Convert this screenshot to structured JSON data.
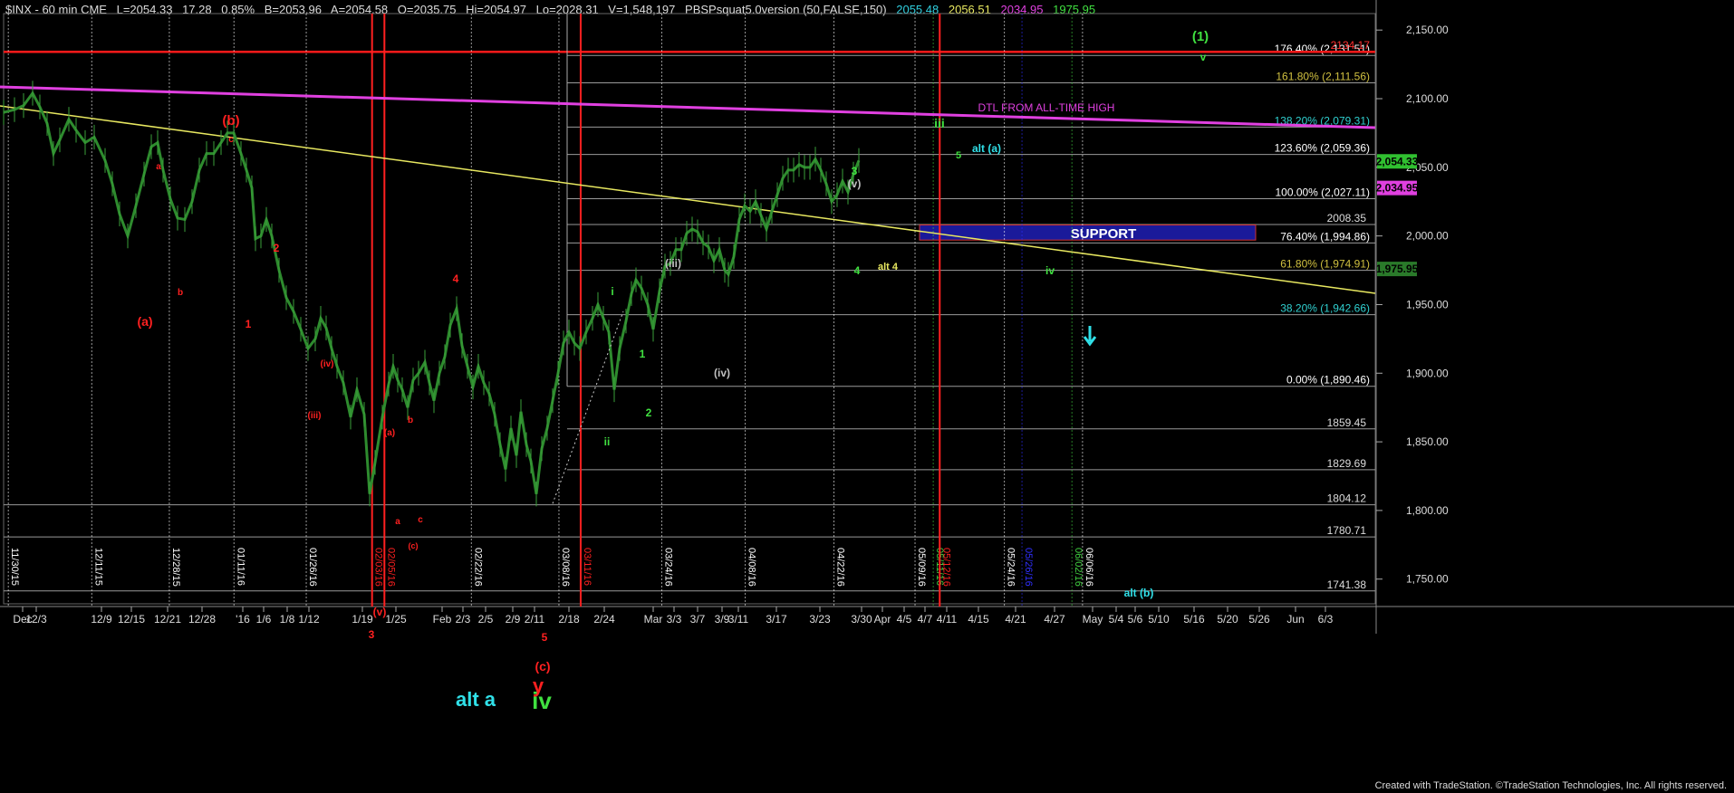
{
  "header": {
    "symbol": "$INX - 60 min  CME",
    "last": "L=2054.33",
    "change": "17.28",
    "change_pct": "0.85%",
    "bid": "B=2053.96",
    "ask": "A=2054.58",
    "open": "O=2035.75",
    "high": "Hi=2054.97",
    "low": "Lo=2028.31",
    "volume": "V=1,548,197",
    "indicator": "PBSPsquat5.0version (50,FALSE,150)",
    "ind_v1": "2055.48",
    "ind_v2": "2056.51",
    "ind_v3": "2034.95",
    "ind_v4": "1975.95"
  },
  "footer": {
    "credit": "Created with TradeStation. ©TradeStation Technologies, Inc. All rights reserved."
  },
  "colors": {
    "background": "#000000",
    "price": "#2e8b2e",
    "red": "#ff1a1a",
    "magenta": "#e040e0",
    "yellow": "#e8e860",
    "cyan": "#30e0e8",
    "green": "#40e040",
    "navy": "#1a1a9a"
  },
  "chart_data": {
    "type": "line",
    "title": "",
    "xlabel": "",
    "ylabel": "",
    "ylim": [
      1732,
      2162
    ],
    "y_ticks": [
      1750,
      1800,
      1850,
      1900,
      1950,
      2000,
      2050,
      2100,
      2150
    ],
    "y_tick_labels": [
      "1,750.00",
      "1,800.00",
      "1,850.00",
      "1,900.00",
      "1,950.00",
      "2,000.00",
      "2,050.00",
      "2,100.00",
      "2,150.00"
    ],
    "x_labels": [
      "Dec",
      "12/3",
      "12/9",
      "12/15",
      "12/21",
      "12/28",
      "'16",
      "1/6",
      "1/8",
      "1/12",
      "1/19",
      "1/25",
      "Feb",
      "2/3",
      "2/5",
      "2/9",
      "2/11",
      "2/18",
      "2/24",
      "Mar",
      "3/3",
      "3/7",
      "3/9",
      "3/11",
      "3/17",
      "3/23",
      "3/30",
      "Apr",
      "4/5",
      "4/7",
      "4/11",
      "4/15",
      "4/21",
      "4/27",
      "May",
      "5/4",
      "5/6",
      "5/10",
      "5/16",
      "5/20",
      "5/26",
      "Jun",
      "6/3"
    ],
    "price_badges": [
      {
        "value": 2054.33,
        "label": "2,054.33",
        "color": "#30c030"
      },
      {
        "value": 2034.95,
        "label": "2,034.95",
        "color": "#e040e0"
      },
      {
        "value": 1975.95,
        "label": "1,975.95",
        "color": "#2a7a2a"
      }
    ],
    "price_series": [
      [
        0,
        2090
      ],
      [
        12,
        2092
      ],
      [
        22,
        2095
      ],
      [
        32,
        2104
      ],
      [
        40,
        2094
      ],
      [
        48,
        2082
      ],
      [
        55,
        2060
      ],
      [
        62,
        2070
      ],
      [
        72,
        2085
      ],
      [
        80,
        2077
      ],
      [
        90,
        2068
      ],
      [
        100,
        2072
      ],
      [
        112,
        2055
      ],
      [
        120,
        2038
      ],
      [
        128,
        2016
      ],
      [
        137,
        2000
      ],
      [
        146,
        2022
      ],
      [
        155,
        2045
      ],
      [
        163,
        2065
      ],
      [
        170,
        2068
      ],
      [
        176,
        2048
      ],
      [
        184,
        2027
      ],
      [
        192,
        2013
      ],
      [
        200,
        2012
      ],
      [
        208,
        2025
      ],
      [
        216,
        2048
      ],
      [
        224,
        2060
      ],
      [
        232,
        2060
      ],
      [
        240,
        2068
      ],
      [
        247,
        2075
      ],
      [
        254,
        2075
      ],
      [
        262,
        2060
      ],
      [
        268,
        2048
      ],
      [
        274,
        2035
      ],
      [
        278,
        1998
      ],
      [
        284,
        2000
      ],
      [
        290,
        2012
      ],
      [
        296,
        2000
      ],
      [
        304,
        1975
      ],
      [
        312,
        1955
      ],
      [
        320,
        1945
      ],
      [
        328,
        1932
      ],
      [
        336,
        1918
      ],
      [
        344,
        1925
      ],
      [
        350,
        1940
      ],
      [
        356,
        1933
      ],
      [
        362,
        1918
      ],
      [
        368,
        1905
      ],
      [
        375,
        1893
      ],
      [
        383,
        1868
      ],
      [
        390,
        1888
      ],
      [
        398,
        1870
      ],
      [
        404,
        1812
      ],
      [
        410,
        1835
      ],
      [
        418,
        1868
      ],
      [
        425,
        1892
      ],
      [
        430,
        1905
      ],
      [
        435,
        1895
      ],
      [
        440,
        1888
      ],
      [
        446,
        1875
      ],
      [
        452,
        1895
      ],
      [
        458,
        1900
      ],
      [
        465,
        1908
      ],
      [
        470,
        1893
      ],
      [
        475,
        1880
      ],
      [
        481,
        1900
      ],
      [
        487,
        1912
      ],
      [
        493,
        1935
      ],
      [
        500,
        1947
      ],
      [
        506,
        1920
      ],
      [
        512,
        1905
      ],
      [
        518,
        1890
      ],
      [
        524,
        1905
      ],
      [
        530,
        1893
      ],
      [
        536,
        1885
      ],
      [
        542,
        1870
      ],
      [
        548,
        1848
      ],
      [
        554,
        1830
      ],
      [
        560,
        1860
      ],
      [
        566,
        1840
      ],
      [
        571,
        1872
      ],
      [
        577,
        1848
      ],
      [
        582,
        1836
      ],
      [
        588,
        1812
      ],
      [
        594,
        1845
      ],
      [
        600,
        1860
      ],
      [
        606,
        1880
      ],
      [
        612,
        1900
      ],
      [
        618,
        1922
      ],
      [
        624,
        1930
      ],
      [
        630,
        1922
      ],
      [
        636,
        1918
      ],
      [
        643,
        1930
      ],
      [
        650,
        1940
      ],
      [
        656,
        1950
      ],
      [
        662,
        1940
      ],
      [
        668,
        1930
      ],
      [
        674,
        1888
      ],
      [
        680,
        1918
      ],
      [
        687,
        1938
      ],
      [
        693,
        1958
      ],
      [
        698,
        1968
      ],
      [
        704,
        1962
      ],
      [
        711,
        1950
      ],
      [
        717,
        1932
      ],
      [
        724,
        1960
      ],
      [
        730,
        1978
      ],
      [
        736,
        1980
      ],
      [
        742,
        1990
      ],
      [
        748,
        1990
      ],
      [
        754,
        2002
      ],
      [
        760,
        2005
      ],
      [
        766,
        2003
      ],
      [
        772,
        1995
      ],
      [
        778,
        1992
      ],
      [
        784,
        1982
      ],
      [
        790,
        1990
      ],
      [
        796,
        1975
      ],
      [
        800,
        1972
      ],
      [
        806,
        1985
      ],
      [
        812,
        2012
      ],
      [
        818,
        2022
      ],
      [
        824,
        2018
      ],
      [
        830,
        2025
      ],
      [
        836,
        2015
      ],
      [
        842,
        2005
      ],
      [
        848,
        2018
      ],
      [
        854,
        2030
      ],
      [
        860,
        2042
      ],
      [
        866,
        2048
      ],
      [
        872,
        2048
      ],
      [
        878,
        2052
      ],
      [
        884,
        2050
      ],
      [
        890,
        2050
      ],
      [
        896,
        2056
      ],
      [
        902,
        2048
      ],
      [
        908,
        2038
      ],
      [
        914,
        2025
      ],
      [
        920,
        2030
      ],
      [
        926,
        2040
      ],
      [
        932,
        2032
      ],
      [
        938,
        2045
      ],
      [
        944,
        2055
      ]
    ],
    "fib_levels": [
      {
        "label": "0.00% (1,890.46)",
        "value": 1890.46,
        "color": "#ffffff"
      },
      {
        "label": "38.20% (1,942.66)",
        "value": 1942.66,
        "color": "#30d0d0"
      },
      {
        "label": "61.80% (1,974.91)",
        "value": 1974.91,
        "color": "#d0c040"
      },
      {
        "label": "76.40% (1,994.86)",
        "value": 1994.86,
        "color": "#ffffff"
      },
      {
        "label": "100.00% (2,027.11)",
        "value": 2027.11,
        "color": "#ffffff"
      },
      {
        "label": "123.60% (2,059.36)",
        "value": 2059.36,
        "color": "#ffffff"
      },
      {
        "label": "138.20% (2,079.31)",
        "value": 2079.31,
        "color": "#30d0d0"
      },
      {
        "label": "161.80% (2,111.56)",
        "value": 2111.56,
        "color": "#d0c040"
      },
      {
        "label": "176.40% (2,131.51)",
        "value": 2131.51,
        "color": "#ffffff"
      },
      {
        "label": "2134.17",
        "value": 2134.17,
        "color": "#ff3030"
      }
    ],
    "hlines": [
      {
        "label": "2008.35",
        "value": 2008.35
      },
      {
        "label": "1859.45",
        "value": 1859.45
      },
      {
        "label": "1829.69",
        "value": 1829.69
      },
      {
        "label": "1804.12",
        "value": 1804.12
      },
      {
        "label": "1780.71",
        "value": 1780.71
      },
      {
        "label": "1741.38",
        "value": 1741.38
      }
    ],
    "support_zone": {
      "label": "SUPPORT",
      "top": 2008,
      "bottom": 1997
    },
    "trendline_labels": {
      "dtl": "DTL FROM ALL-TIME HIGH"
    },
    "vlines": [
      {
        "label": "11/30/15",
        "color": "#ffffff"
      },
      {
        "label": "12/11/15",
        "color": "#ffffff"
      },
      {
        "label": "12/28/15",
        "color": "#ffffff"
      },
      {
        "label": "01/11/16",
        "color": "#ffffff"
      },
      {
        "label": "01/26/16",
        "color": "#ffffff"
      },
      {
        "label": "02/03/16",
        "color": "#ff2020"
      },
      {
        "label": "02/05/16",
        "color": "#ff2020"
      },
      {
        "label": "02/22/16",
        "color": "#ffffff"
      },
      {
        "label": "03/08/16",
        "color": "#ffffff"
      },
      {
        "label": "03/11/16",
        "color": "#ff2020"
      },
      {
        "label": "03/24/16",
        "color": "#ffffff"
      },
      {
        "label": "04/08/16",
        "color": "#ffffff"
      },
      {
        "label": "04/22/16",
        "color": "#ffffff"
      },
      {
        "label": "05/09/16",
        "color": "#ffffff"
      },
      {
        "label": "05/11/16",
        "color": "#40d040"
      },
      {
        "label": "05/12/16",
        "color": "#ff2020"
      },
      {
        "label": "05/24/16",
        "color": "#ffffff"
      },
      {
        "label": "05/26/16",
        "color": "#3030ff"
      },
      {
        "label": "06/02/16",
        "color": "#40d040"
      },
      {
        "label": "06/06/16",
        "color": "#ffffff"
      }
    ],
    "annotations": [
      {
        "text": "(a)",
        "color": "#ff2020"
      },
      {
        "text": "a",
        "color": "#ff2020"
      },
      {
        "text": "b",
        "color": "#ff2020"
      },
      {
        "text": "(b)",
        "color": "#ff2020"
      },
      {
        "text": "c",
        "color": "#ff2020"
      },
      {
        "text": "1",
        "color": "#ff2020"
      },
      {
        "text": "2",
        "color": "#ff2020"
      },
      {
        "text": "(iv)",
        "color": "#ff2020"
      },
      {
        "text": "(iii)",
        "color": "#ff2020"
      },
      {
        "text": "(v)",
        "color": "#ff2020"
      },
      {
        "text": "3",
        "color": "#ff2020"
      },
      {
        "text": "(a)",
        "color": "#ff2020"
      },
      {
        "text": "b",
        "color": "#ff2020"
      },
      {
        "text": "a",
        "color": "#ff2020"
      },
      {
        "text": "c",
        "color": "#ff2020"
      },
      {
        "text": "(c)",
        "color": "#ff2020"
      },
      {
        "text": "4",
        "color": "#ff2020"
      },
      {
        "text": "5",
        "color": "#ff2020"
      },
      {
        "text": "(c)",
        "color": "#ff2020"
      },
      {
        "text": "y",
        "color": "#ff2020"
      },
      {
        "text": "alt a",
        "color": "#30e0e8"
      },
      {
        "text": "iv",
        "color": "#40e040"
      },
      {
        "text": "i",
        "color": "#40e040"
      },
      {
        "text": "ii",
        "color": "#40e040"
      },
      {
        "text": "1",
        "color": "#40e040"
      },
      {
        "text": "2",
        "color": "#40e040"
      },
      {
        "text": "(iii)",
        "color": "#c0c0c0"
      },
      {
        "text": "(iv)",
        "color": "#c0c0c0"
      },
      {
        "text": "3",
        "color": "#40e040"
      },
      {
        "text": "(v)",
        "color": "#c0c0c0"
      },
      {
        "text": "4",
        "color": "#40e040"
      },
      {
        "text": "alt 4",
        "color": "#e8e860"
      },
      {
        "text": "iii",
        "color": "#40e040"
      },
      {
        "text": "5",
        "color": "#40e040"
      },
      {
        "text": "alt (a)",
        "color": "#30e0e8"
      },
      {
        "text": "iv",
        "color": "#40e040"
      },
      {
        "text": "(1)",
        "color": "#40e040"
      },
      {
        "text": "v",
        "color": "#40e040"
      },
      {
        "text": "alt (b)",
        "color": "#30e0e8"
      },
      {
        "text": "DTL FROM ALL-TIME HIGH",
        "color": "#e040e0"
      }
    ]
  }
}
